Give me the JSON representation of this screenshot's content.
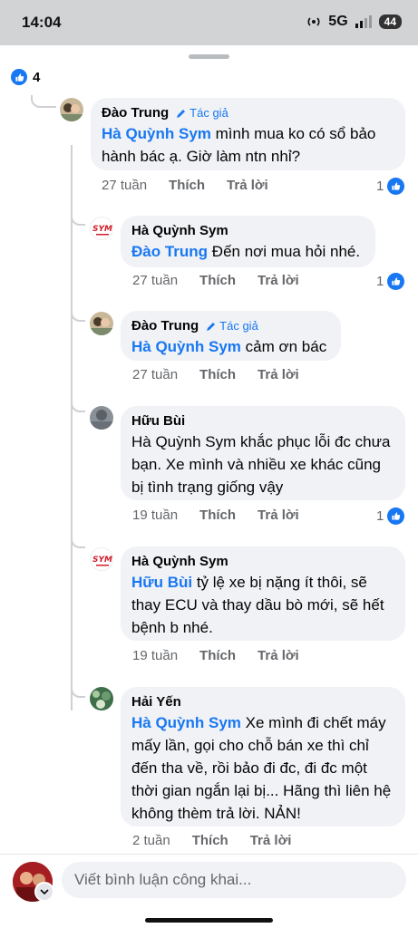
{
  "status_bar": {
    "time": "14:04",
    "network": "5G",
    "battery": "44"
  },
  "reactions": {
    "count": "4",
    "icon": "like-icon"
  },
  "comments": [
    {
      "author": "Đào Trung",
      "badge": "Tác giả",
      "mention": "Hà Quỳnh Sym",
      "text": " mình mua ko có sổ bảo hành bác ạ. Giờ làm ntn nhỉ?",
      "age": "27 tuần",
      "like_label": "Thích",
      "reply_label": "Trả lời",
      "like_count": "1"
    },
    {
      "author": "Hà Quỳnh Sym",
      "mention": "Đào Trung",
      "text": " Đến nơi mua hỏi nhé.",
      "age": "27 tuần",
      "like_label": "Thích",
      "reply_label": "Trả lời",
      "like_count": "1"
    },
    {
      "author": "Đào Trung",
      "badge": "Tác giả",
      "mention": "Hà Quỳnh Sym",
      "text": " cảm ơn bác",
      "age": "27 tuần",
      "like_label": "Thích",
      "reply_label": "Trả lời"
    },
    {
      "author": "Hữu Bùi",
      "text": "Hà Quỳnh Sym khắc phục lỗi đc chưa bạn. Xe mình và nhiều xe khác cũng bị tình trạng giống vậy",
      "age": "19 tuần",
      "like_label": "Thích",
      "reply_label": "Trả lời",
      "like_count": "1"
    },
    {
      "author": "Hà Quỳnh Sym",
      "mention": "Hữu Bùi",
      "text": " tỷ lệ xe bị nặng ít thôi, sẽ thay ECU và thay dầu bò mới, sẽ hết bệnh b nhé.",
      "age": "19 tuần",
      "like_label": "Thích",
      "reply_label": "Trả lời"
    },
    {
      "author": "Hải Yến",
      "mention": "Hà Quỳnh Sym",
      "text": " Xe mình đi chết máy mấy lần, gọi cho chỗ bán xe thì chỉ đến tha về, rồi bảo đi đc, đi đc một thời gian ngắn lại bị... Hãng thì liên hệ không thèm trả lời. NẢN!",
      "age": "2 tuần",
      "like_label": "Thích",
      "reply_label": "Trả lời"
    }
  ],
  "sym_logo_text": "SYM",
  "composer": {
    "placeholder": "Viết bình luận công khai..."
  },
  "colors": {
    "accent": "#1877f2",
    "bubble": "#f0f2f5",
    "muted": "#65676b"
  }
}
